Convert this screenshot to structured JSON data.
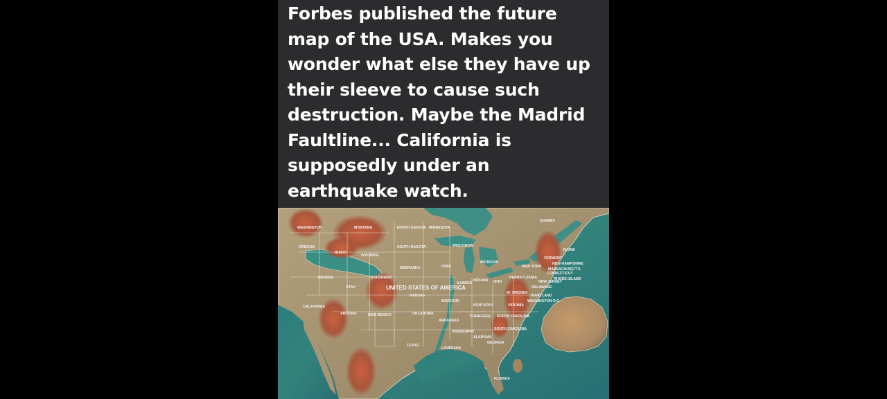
{
  "post": {
    "caption": "Forbes published the future map of the USA. Makes you wonder what else they have up their sleeve to cause such destruction. Maybe the Madrid Faultline... California is supposedly under an earthquake watch."
  },
  "map": {
    "country_label": "UNITED STATES OF AMERICA",
    "state_labels": {
      "washington": "WASHINGTON",
      "oregon": "OREGON",
      "idaho": "IDAHO",
      "montana": "MONTANA",
      "wyoming": "WYOMING",
      "north_dakota": "NORTH DAKOTA",
      "south_dakota": "SOUTH DAKOTA",
      "minnesota": "MINNESOTA",
      "wisconsin": "WISCONSIN",
      "michigan": "MICHIGAN",
      "nebraska": "NEBRASKA",
      "iowa": "IOWA",
      "illinois": "ILLINOIS",
      "indiana": "INDIANA",
      "ohio": "OHIO",
      "nevada": "NEVADA",
      "utah": "UTAH",
      "colorado": "COLORADO",
      "kansas": "KANSAS",
      "missouri": "MISSOURI",
      "kentucky": "KENTUCKY",
      "virginia": "VIRGINIA",
      "california": "CALIFORNIA",
      "arizona": "ARIZONA",
      "new_mexico": "NEW MEXICO",
      "oklahoma": "OKLAHOMA",
      "arkansas": "ARKANSAS",
      "tennessee": "TENNESSEE",
      "north_carolina": "NORTH CAROLINA",
      "south_carolina": "SOUTH CAROLINA",
      "mississippi": "MISSISSIPPI",
      "alabama": "ALABAMA",
      "georgia": "GEORGIA",
      "texas": "TEXAS",
      "louisiana": "LOUISIANA",
      "florida": "FLORIDA",
      "quebec": "QUEBEC",
      "maine": "MAINE",
      "vermont": "VERMONT",
      "new_hampshire": "NEW HAMPSHIRE",
      "new_york": "NEW YORK",
      "massachusetts": "MASSACHUSETTS",
      "connecticut": "CONNECTICUT",
      "rhode_island": "RHODE ISLAND",
      "pennsylvania": "PENNSYLVANIA",
      "new_jersey": "NEW JERSEY",
      "delaware": "DELAWARE",
      "maryland": "MARYLAND",
      "washington_dc": "WASHINGTON D.C.",
      "west_virginia": "W. VIRGINIA"
    },
    "colors": {
      "sea": "#2f7d7a",
      "land": "#a89878",
      "highland": "#b4513a",
      "caption_bg": "#2c2c2e"
    }
  }
}
